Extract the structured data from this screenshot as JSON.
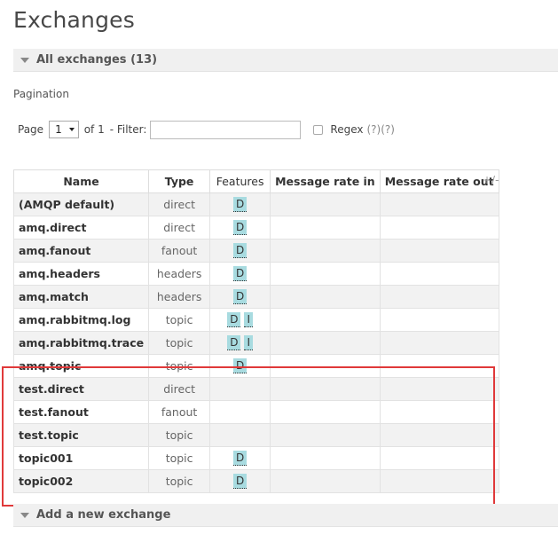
{
  "page": {
    "title": "Exchanges"
  },
  "all_exchanges": {
    "label": "All exchanges (13)"
  },
  "pagination": {
    "label": "Pagination",
    "page_label": "Page",
    "page_value": "1",
    "of_label": "of 1",
    "filter_label": "- Filter:",
    "filter_value": "",
    "regex_label": "Regex",
    "regex_help": "(?)(?)"
  },
  "table": {
    "headers": [
      "Name",
      "Type",
      "Features",
      "Message rate in",
      "Message rate out"
    ],
    "plusminus": "+/-",
    "rows": [
      {
        "name": "(AMQP default)",
        "type": "direct",
        "features": [
          "D"
        ]
      },
      {
        "name": "amq.direct",
        "type": "direct",
        "features": [
          "D"
        ]
      },
      {
        "name": "amq.fanout",
        "type": "fanout",
        "features": [
          "D"
        ]
      },
      {
        "name": "amq.headers",
        "type": "headers",
        "features": [
          "D"
        ]
      },
      {
        "name": "amq.match",
        "type": "headers",
        "features": [
          "D"
        ]
      },
      {
        "name": "amq.rabbitmq.log",
        "type": "topic",
        "features": [
          "D",
          "I"
        ]
      },
      {
        "name": "amq.rabbitmq.trace",
        "type": "topic",
        "features": [
          "D",
          "I"
        ]
      },
      {
        "name": "amq.topic",
        "type": "topic",
        "features": [
          "D"
        ]
      },
      {
        "name": "test.direct",
        "type": "direct",
        "features": []
      },
      {
        "name": "test.fanout",
        "type": "fanout",
        "features": []
      },
      {
        "name": "test.topic",
        "type": "topic",
        "features": []
      },
      {
        "name": "topic001",
        "type": "topic",
        "features": [
          "D"
        ]
      },
      {
        "name": "topic002",
        "type": "topic",
        "features": [
          "D"
        ]
      }
    ]
  },
  "add_exchange": {
    "label": "Add a new exchange"
  },
  "colors": {
    "highlight": "#e0393a",
    "badge": "#a8dbe0"
  }
}
